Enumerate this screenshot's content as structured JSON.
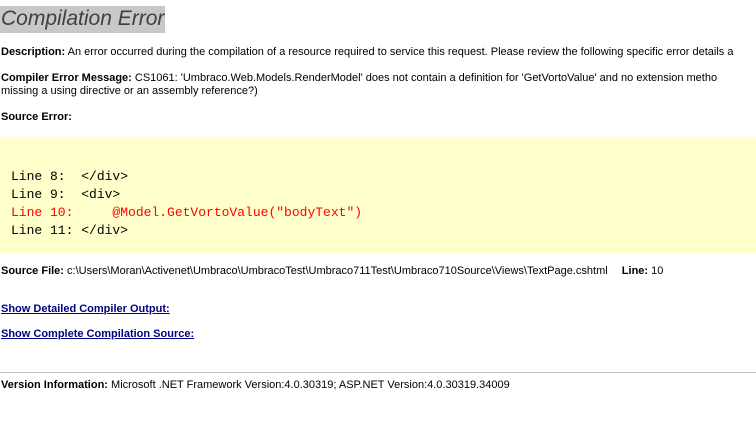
{
  "title": "Compilation Error",
  "description": {
    "label": "Description:",
    "text": "An error occurred during the compilation of a resource required to service this request. Please review the following specific error details a"
  },
  "compiler_error": {
    "label": "Compiler Error Message:",
    "text_line1": "CS1061: 'Umbraco.Web.Models.RenderModel' does not contain a definition for 'GetVortoValue' and no extension metho",
    "text_line2": "missing a using directive or an assembly reference?)"
  },
  "source_error_label": "Source Error:",
  "code_lines": [
    {
      "text": "Line 8:  </div>",
      "error": false
    },
    {
      "text": "Line 9:  <div>",
      "error": false
    },
    {
      "text": "Line 10:     @Model.GetVortoValue(\"bodyText\")",
      "error": true
    },
    {
      "text": "Line 11: </div>",
      "error": false
    }
  ],
  "source_file": {
    "label": "Source File:",
    "path": "c:\\Users\\Moran\\Activenet\\Umbraco\\UmbracoTest\\Umbraco711Test\\Umbraco710Source\\Views\\TextPage.cshtml",
    "line_label": "Line:",
    "line_value": "10"
  },
  "links": {
    "detailed_output": "Show Detailed Compiler Output:",
    "complete_source": "Show Complete Compilation Source:"
  },
  "version": {
    "label": "Version Information:",
    "text": "Microsoft .NET Framework Version:4.0.30319; ASP.NET Version:4.0.30319.34009"
  },
  "colors": {
    "code_background": "#ffffcc",
    "error_line": "#ff0000",
    "link": "#000080",
    "title_background": "#c8c8c8"
  }
}
